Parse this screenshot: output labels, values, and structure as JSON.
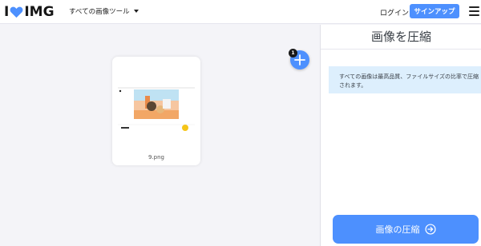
{
  "header": {
    "logo_left": "I",
    "logo_right": "IMG",
    "tools_menu_label": "すべての画像ツール",
    "login_label": "ログイン",
    "signup_label": "サインアップ"
  },
  "workspace": {
    "file_count": "1",
    "files": [
      {
        "name": "9.png"
      }
    ]
  },
  "sidebar": {
    "title": "画像を圧縮",
    "info_text": "すべての画像は最高品質、ファイルサイズの比率で圧縮されます。",
    "compress_button_label": "画像の圧縮"
  },
  "colors": {
    "brand": "#4d90fe",
    "info_background": "#ddeffd"
  }
}
